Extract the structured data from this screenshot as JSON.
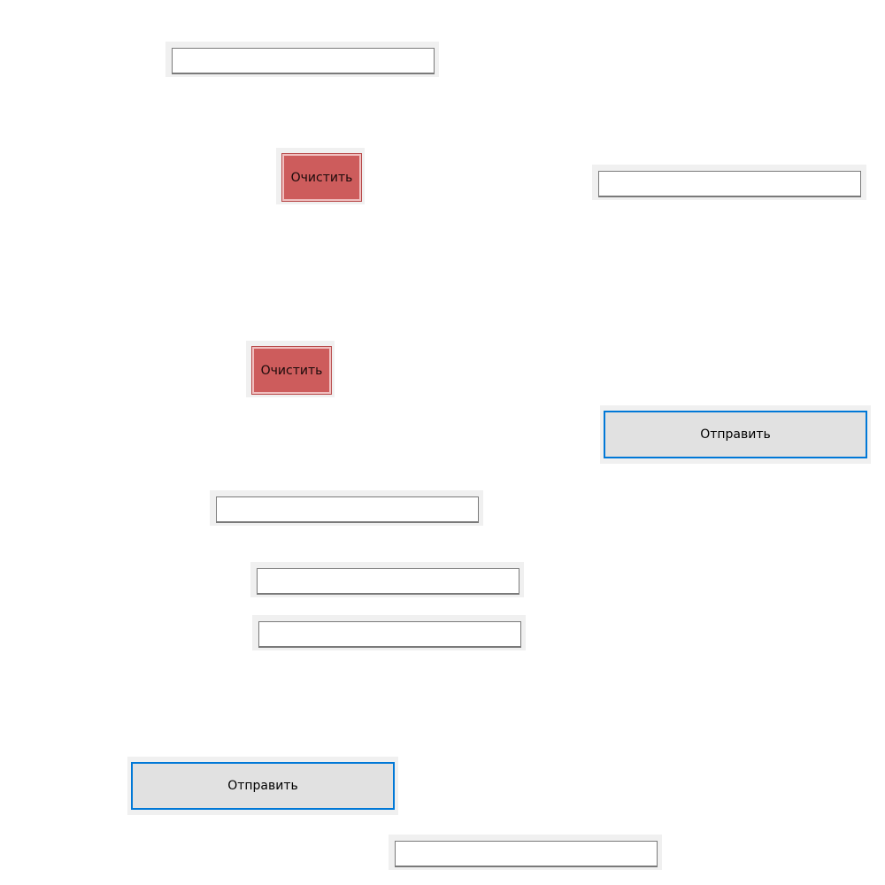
{
  "buttons": {
    "clear_label": "Очистить",
    "send_label": "Отправить"
  },
  "fields": {
    "field_1": {
      "value": "",
      "placeholder": ""
    },
    "field_2": {
      "value": "",
      "placeholder": ""
    },
    "field_3": {
      "value": "",
      "placeholder": ""
    },
    "field_4": {
      "value": "",
      "placeholder": ""
    },
    "field_5": {
      "value": "",
      "placeholder": ""
    },
    "field_6": {
      "value": "",
      "placeholder": ""
    }
  },
  "colors": {
    "clear_button_bg": "#cd5c5c",
    "send_button_border": "#0078d7",
    "send_button_bg": "#e1e1e1",
    "cell_bg": "#f0f0f0"
  }
}
